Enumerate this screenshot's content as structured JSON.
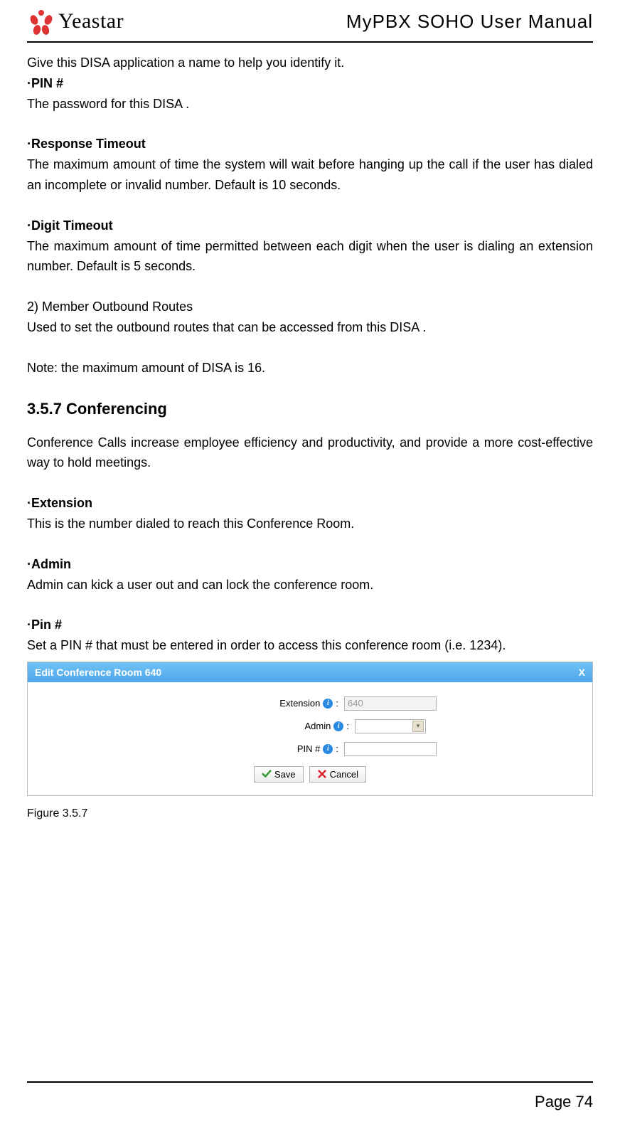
{
  "header": {
    "brand": "Yeastar",
    "doc_title": "MyPBX SOHO User Manual"
  },
  "body": {
    "p1": "Give this DISA application a name to help you identify it.",
    "pin_hdr": "·PIN #",
    "pin_txt": "The password for this DISA .",
    "rt_hdr": "·Response Timeout",
    "rt_txt": "The maximum amount of time the system will wait before hanging up the call if the user has dialed an incomplete or invalid number. Default is 10 seconds.",
    "dt_hdr": "·Digit Timeout",
    "dt_txt": "The maximum amount of time permitted between each digit when the user is dialing an extension number. Default is 5 seconds.",
    "mor_hdr": "2) Member Outbound Routes",
    "mor_txt": "Used to set the outbound routes that can be accessed from this DISA .",
    "note": "Note: the maximum amount of DISA is 16.",
    "sec_title": "3.5.7 Conferencing",
    "conf_intro": "Conference Calls increase employee efficiency and productivity, and provide a more cost-effective way to hold meetings.",
    "ext_hdr": "·Extension",
    "ext_txt": "This is the number dialed to reach this Conference Room.",
    "adm_hdr": "·Admin",
    "adm_txt": "Admin can kick a user out and can lock the conference room.",
    "pin2_hdr": "·Pin #",
    "pin2_txt": "Set a PIN # that must be entered in order to access this conference room (i.e. 1234)."
  },
  "dialog": {
    "title": "Edit Conference Room 640",
    "close": "X",
    "labels": {
      "extension": "Extension",
      "admin": "Admin",
      "pin": "PIN #"
    },
    "values": {
      "extension": "640"
    },
    "buttons": {
      "save": "Save",
      "cancel": "Cancel"
    }
  },
  "caption": "Figure 3.5.7",
  "footer": "Page 74"
}
